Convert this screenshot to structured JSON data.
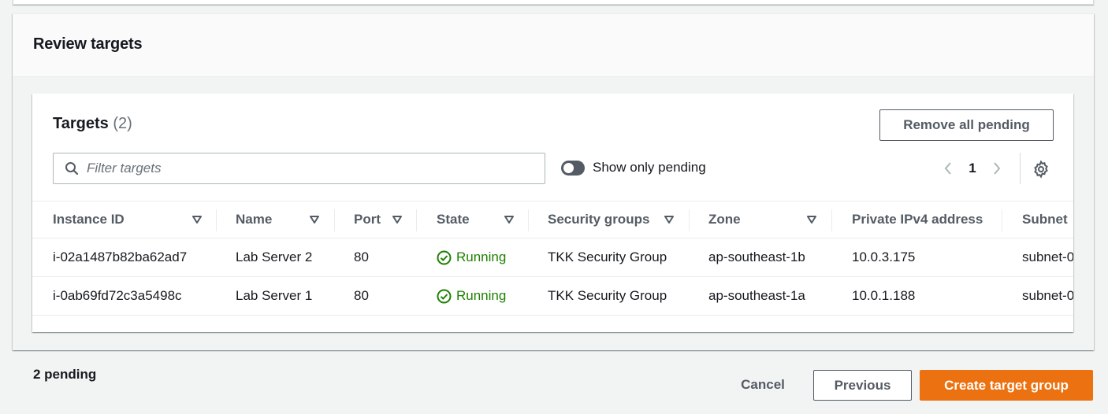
{
  "review": {
    "title": "Review targets"
  },
  "targets": {
    "title": "Targets",
    "count": "(2)",
    "remove_all_label": "Remove all pending",
    "filter_placeholder": "Filter targets",
    "toggle_label": "Show only pending",
    "toggle_on": false,
    "page": "1",
    "columns": [
      {
        "label": "Instance ID",
        "sortable": true
      },
      {
        "label": "Name",
        "sortable": true
      },
      {
        "label": "Port",
        "sortable": true
      },
      {
        "label": "State",
        "sortable": true
      },
      {
        "label": "Security groups",
        "sortable": true
      },
      {
        "label": "Zone",
        "sortable": true
      },
      {
        "label": "Private IPv4 address",
        "sortable": false
      },
      {
        "label": "Subnet",
        "sortable": false
      }
    ],
    "rows": [
      {
        "instance_id": "i-02a1487b82ba62ad7",
        "name": "Lab Server 2",
        "port": "80",
        "state": "Running",
        "security_group": "TKK Security Group",
        "zone": "ap-southeast-1b",
        "ipv4": "10.0.3.175",
        "subnet": "subnet-0"
      },
      {
        "instance_id": "i-0ab69fd72c3a5498c",
        "name": "Lab Server 1",
        "port": "80",
        "state": "Running",
        "security_group": "TKK Security Group",
        "zone": "ap-southeast-1a",
        "ipv4": "10.0.1.188",
        "subnet": "subnet-0"
      }
    ]
  },
  "footer": {
    "pending_text": "2 pending",
    "cancel_label": "Cancel",
    "previous_label": "Previous",
    "create_label": "Create target group"
  },
  "colors": {
    "primary_button": "#ec7211",
    "running_status": "#1d8102",
    "page_background": "#f2f3f3"
  }
}
